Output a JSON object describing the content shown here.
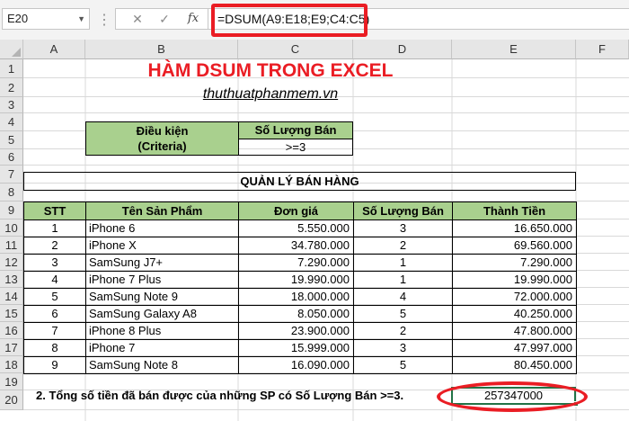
{
  "formula_bar": {
    "name_box": "E20",
    "name_box_dropdown_icon": "chevron-down-icon",
    "cancel_icon": "✕",
    "enter_icon": "✓",
    "function_icon": "fx",
    "formula": "=DSUM(A9:E18;E9;C4:C5)"
  },
  "columns": [
    "A",
    "B",
    "C",
    "D",
    "E",
    "F"
  ],
  "rows": [
    "1",
    "2",
    "3",
    "4",
    "5",
    "6",
    "7",
    "8",
    "9",
    "10",
    "11",
    "12",
    "13",
    "14",
    "15",
    "16",
    "17",
    "18",
    "19",
    "20"
  ],
  "title": "HÀM DSUM TRONG EXCEL",
  "subtitle": "thuthuatphanmem.vn",
  "criteria": {
    "label_line1": "Điều kiện",
    "label_line2": "(Criteria)",
    "field": "Số Lượng Bán",
    "value": ">=3"
  },
  "table_title": "QUẢN LÝ BÁN HÀNG",
  "headers": [
    "STT",
    "Tên Sản Phẩm",
    "Đơn giá",
    "Số Lượng Bán",
    "Thành Tiền"
  ],
  "table_rows": [
    [
      "1",
      "iPhone 6",
      "5.550.000",
      "3",
      "16.650.000"
    ],
    [
      "2",
      "iPhone X",
      "34.780.000",
      "2",
      "69.560.000"
    ],
    [
      "3",
      "SamSung J7+",
      "7.290.000",
      "1",
      "7.290.000"
    ],
    [
      "4",
      "iPhone 7 Plus",
      "19.990.000",
      "1",
      "19.990.000"
    ],
    [
      "5",
      "SamSung Note 9",
      "18.000.000",
      "4",
      "72.000.000"
    ],
    [
      "6",
      "SamSung Galaxy A8",
      "8.050.000",
      "5",
      "40.250.000"
    ],
    [
      "7",
      "iPhone 8 Plus",
      "23.900.000",
      "2",
      "47.800.000"
    ],
    [
      "8",
      "iPhone 7",
      "15.999.000",
      "3",
      "47.997.000"
    ],
    [
      "9",
      "SamSung Note 8",
      "16.090.000",
      "5",
      "80.450.000"
    ]
  ],
  "summary": {
    "label": "2. Tổng số tiền đã bán được của những SP có Số Lượng Bán >=3.",
    "result": "257347000"
  },
  "colors": {
    "accent_red": "#ea1d24",
    "header_green": "#a9d08e",
    "selection_green": "#217346"
  }
}
